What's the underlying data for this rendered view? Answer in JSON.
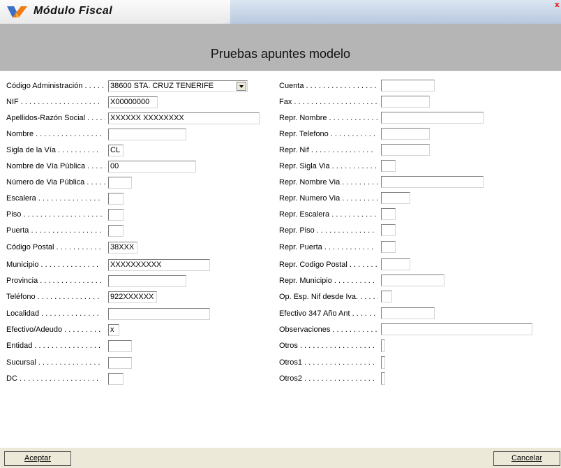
{
  "window": {
    "title": "Módulo Fiscal",
    "close_glyph": "x"
  },
  "form": {
    "heading": "Pruebas apuntes modelo",
    "left": [
      {
        "key": "L",
        "label": "Código Administración . . . . . .",
        "value": "38600 STA. CRUZ TENERIFE",
        "type": "select"
      },
      {
        "key": "N",
        "label": "NIF . . . . . . . . . . . . . . . . . . .",
        "value": "X00000000",
        "type": "text"
      },
      {
        "key": "A",
        "label": "Apellidos-Razón Social . . . . .",
        "value": "XXXXXX XXXXXXXX",
        "type": "text"
      },
      {
        "key": "N",
        "label": "Nombre . . . . . . . . . . . . . . . .",
        "value": "",
        "type": "text"
      },
      {
        "key": "S",
        "label": "Sigla de la Vía . . . . . . . . . .",
        "value": "CL",
        "type": "text"
      },
      {
        "key": "N",
        "label": "Nombre de Vía Pública . . . . .",
        "value": "00",
        "type": "text"
      },
      {
        "key": "N",
        "label": "Número de Via Pública . . . . .",
        "value": "",
        "type": "text"
      },
      {
        "key": "E",
        "label": "Escalera . . . . . . . . . . . . . . .",
        "value": "",
        "type": "text"
      },
      {
        "key": "P",
        "label": "Piso . . . . . . . . . . . . . . . . . . .",
        "value": "",
        "type": "text"
      },
      {
        "key": "P",
        "label": "Puerta . . . . . . . . . . . . . . . . .",
        "value": "",
        "type": "text"
      },
      {
        "key": "C",
        "label": "Código Postal . . . . . . . . . . .",
        "value": "38XXX",
        "type": "text"
      },
      {
        "key": "M",
        "label": "Municipio . . . . . . . . . . . . . .",
        "value": "XXXXXXXXXX",
        "type": "text"
      },
      {
        "key": "P",
        "label": "Provincia . . . . . . . . . . . . . . .",
        "value": "",
        "type": "text"
      },
      {
        "key": "T",
        "label": "Teléfono . . . . . . . . . . . . . . .",
        "value": "922XXXXXX",
        "type": "text"
      },
      {
        "key": "L",
        "label": "Localidad . . . . . . . . . . . . . .",
        "value": "",
        "type": "text"
      },
      {
        "key": "E",
        "label": "Efectivo/Adeudo . . . . . . . . .",
        "value": "x",
        "type": "text"
      },
      {
        "key": "E",
        "label": "Entidad . . . . . . . . . . . . . . . .",
        "value": "",
        "type": "text"
      },
      {
        "key": "S",
        "label": "Sucursal . . . . . . . . . . . . . . .",
        "value": "",
        "type": "text"
      },
      {
        "key": "D",
        "label": "DC . . . . . . . . . . . . . . . . . . .",
        "value": "",
        "type": "text"
      }
    ],
    "right": [
      {
        "label": "Cuenta . . . . . . . . . . . . . . . . .",
        "value": "",
        "type": "text"
      },
      {
        "label": "Fax . . . . . . . . . . . . . . . . . . . .",
        "value": "",
        "type": "text"
      },
      {
        "label": "Repr. Nombre . . . . . . . . . . . .",
        "value": "",
        "type": "text"
      },
      {
        "label": "Repr. Telefono . . . . . . . . . . .",
        "value": "",
        "type": "text"
      },
      {
        "label": "Repr. Nif . . . . . . . . . . . . . . .",
        "value": "",
        "type": "text"
      },
      {
        "label": "Repr. Sigla Via . . . . . . . . . . .",
        "value": "",
        "type": "text"
      },
      {
        "label": "Repr. Nombre Via . . . . . . . . .",
        "value": "",
        "type": "text"
      },
      {
        "label": "Repr. Numero Via . . . . . . . . .",
        "value": "",
        "type": "text"
      },
      {
        "label": "Repr. Escalera . . . . . . . . . . .",
        "value": "",
        "type": "text"
      },
      {
        "label": "Repr. Piso . . . . . . . . . . . . . .",
        "value": "",
        "type": "text"
      },
      {
        "label": "Repr. Puerta . . . . . . . . . . . .",
        "value": "",
        "type": "text"
      },
      {
        "label": "Repr. Codigo Postal . . . . . . .",
        "value": "",
        "type": "text"
      },
      {
        "label": "Repr. Municipio . . . . . . . . . .",
        "value": "",
        "type": "text"
      },
      {
        "label": "Op. Esp. Nif desde Iva. . . . . .",
        "value": "",
        "type": "text"
      },
      {
        "label": "Efectivo 347 Año Ant . . . . . .",
        "value": "",
        "type": "text"
      },
      {
        "label": "Observaciones . . . . . . . . . . .",
        "value": "",
        "type": "text"
      },
      {
        "label": "Otros . . . . . . . . . . . . . . . . . .",
        "value": "",
        "type": "checkbox"
      },
      {
        "label": "Otros1 . . . . . . . . . . . . . . . . .",
        "value": "",
        "type": "checkbox"
      },
      {
        "label": "Otros2 . . . . . . . . . . . . . . . . .",
        "value": "",
        "type": "checkbox"
      }
    ]
  },
  "buttons": {
    "accept": "Aceptar",
    "cancel": "Cancelar"
  }
}
